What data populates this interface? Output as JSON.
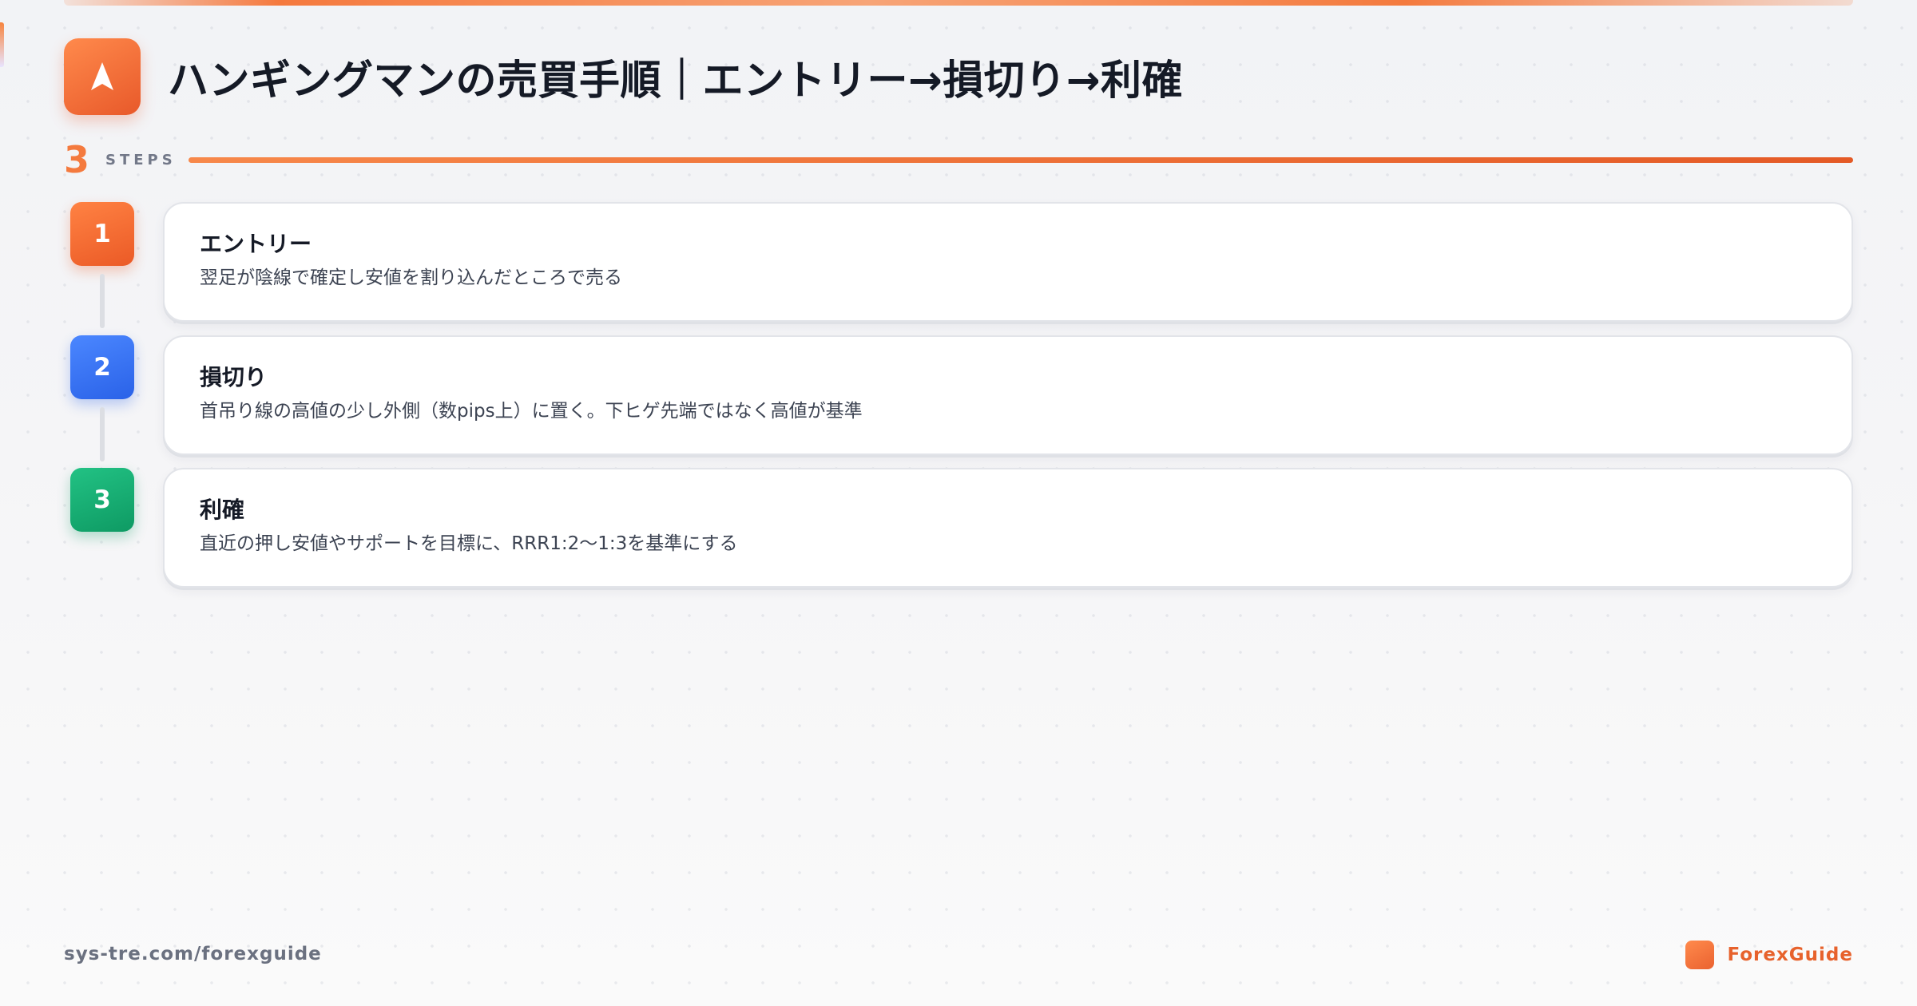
{
  "header": {
    "title": "ハンギングマンの売買手順｜エントリー→損切り→利確",
    "icon": "navigation-arrow-icon"
  },
  "steps_header": {
    "count": "3",
    "label": "STEPS"
  },
  "steps": [
    {
      "number": "1",
      "title": "エントリー",
      "description": "翌足が陰線で確定し安値を割り込んだところで売る",
      "color": "#f26a32"
    },
    {
      "number": "2",
      "title": "損切り",
      "description": "首吊り線の高値の少し外側（数pips上）に置く。下ヒゲ先端ではなく高値が基準",
      "color": "#3571f2"
    },
    {
      "number": "3",
      "title": "利確",
      "description": "直近の押し安値やサポートを目標に、RRR1:2〜1:3を基準にする",
      "color": "#16ad71"
    }
  ],
  "footer": {
    "url": "sys-tre.com/forexguide",
    "brand": "ForexGuide"
  },
  "colors": {
    "accent": "#f47a3e",
    "text": "#151a26"
  }
}
